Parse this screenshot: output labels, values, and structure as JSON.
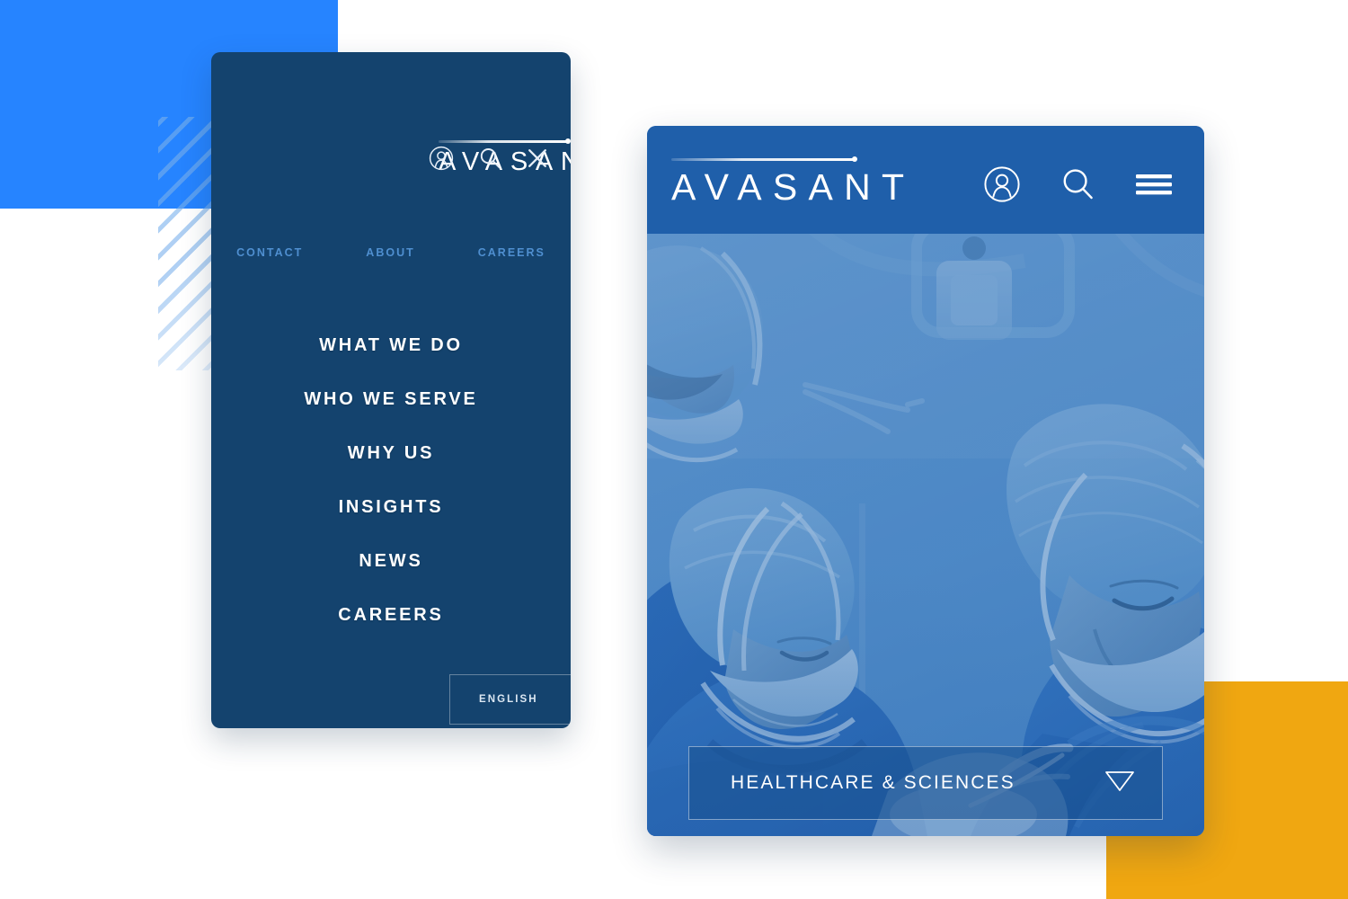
{
  "brand": {
    "logo_text": "AVASANT",
    "logo_icon": "avasant-wordmark-with-rule-and-dot"
  },
  "colors": {
    "deco_blue": "#2684FF",
    "deco_orange": "#F0A711",
    "deco_stripes": "#78AFEB",
    "panel_dark_navy": "#14436E",
    "panel_header_blue": "#1F5FAA",
    "quicklink_blue": "#4F8FD0",
    "page_background": "#FFFFFF"
  },
  "menu_panel": {
    "header": {
      "logo_text": "AVASANT",
      "icons": [
        {
          "name": "user-account-icon",
          "glyph": "user"
        },
        {
          "name": "search-icon",
          "glyph": "search"
        },
        {
          "name": "close-icon",
          "glyph": "close"
        }
      ]
    },
    "quick_links": [
      {
        "label": "CONTACT"
      },
      {
        "label": "ABOUT"
      },
      {
        "label": "CAREERS"
      }
    ],
    "main_nav": [
      {
        "label": "WHAT WE DO"
      },
      {
        "label": "WHO WE SERVE"
      },
      {
        "label": "WHY US"
      },
      {
        "label": "INSIGHTS"
      },
      {
        "label": "NEWS"
      },
      {
        "label": "CAREERS"
      }
    ],
    "language_select": {
      "value": "ENGLISH",
      "arrow_icon": "triangle-down-icon"
    }
  },
  "hero_panel": {
    "header": {
      "logo_text": "AVASANT",
      "icons": [
        {
          "name": "user-account-icon",
          "glyph": "user"
        },
        {
          "name": "search-icon",
          "glyph": "search"
        },
        {
          "name": "hamburger-menu-icon",
          "glyph": "hamburger"
        }
      ]
    },
    "image": {
      "name": "operating-room-surgeons-photo",
      "description": "Surgical team in scrubs and masks operating under bright light, blue duotone overlay"
    },
    "industry_select": {
      "value": "HEALTHCARE & SCIENCES",
      "arrow_icon": "triangle-down-icon"
    }
  },
  "decorations": [
    {
      "name": "blue-square-top-left"
    },
    {
      "name": "diagonal-stripes-square"
    },
    {
      "name": "orange-square-bottom-right"
    }
  ]
}
